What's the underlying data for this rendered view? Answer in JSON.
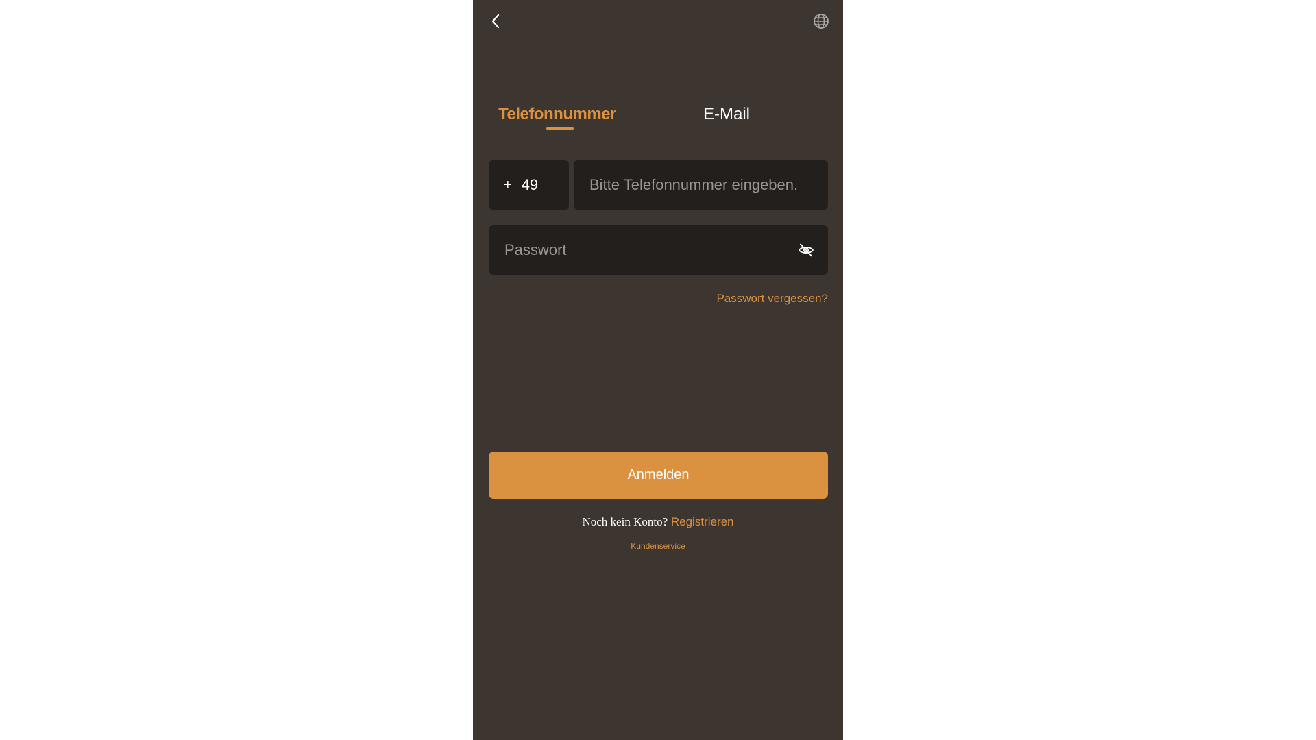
{
  "colors": {
    "background": "#3d3530",
    "field_bg": "#231f1c",
    "accent": "#db913f",
    "primary_button": "#da9140"
  },
  "header": {
    "back_icon": "chevron-left-icon",
    "language_icon": "globe-icon"
  },
  "tabs": [
    {
      "label": "Telefonnummer",
      "active": true
    },
    {
      "label": "E-Mail",
      "active": false
    }
  ],
  "form": {
    "country_code_prefix": "+",
    "country_code": "49",
    "phone_placeholder": "Bitte Telefonnummer eingeben.",
    "phone_value": "",
    "password_placeholder": "Passwort",
    "password_value": "",
    "password_toggle_icon": "eye-off-icon",
    "forgot_password": "Passwort vergessen?"
  },
  "actions": {
    "login_label": "Anmelden",
    "no_account_text": "Noch kein Konto?",
    "register_label": "Registrieren",
    "support_label": "Kundenservice"
  }
}
